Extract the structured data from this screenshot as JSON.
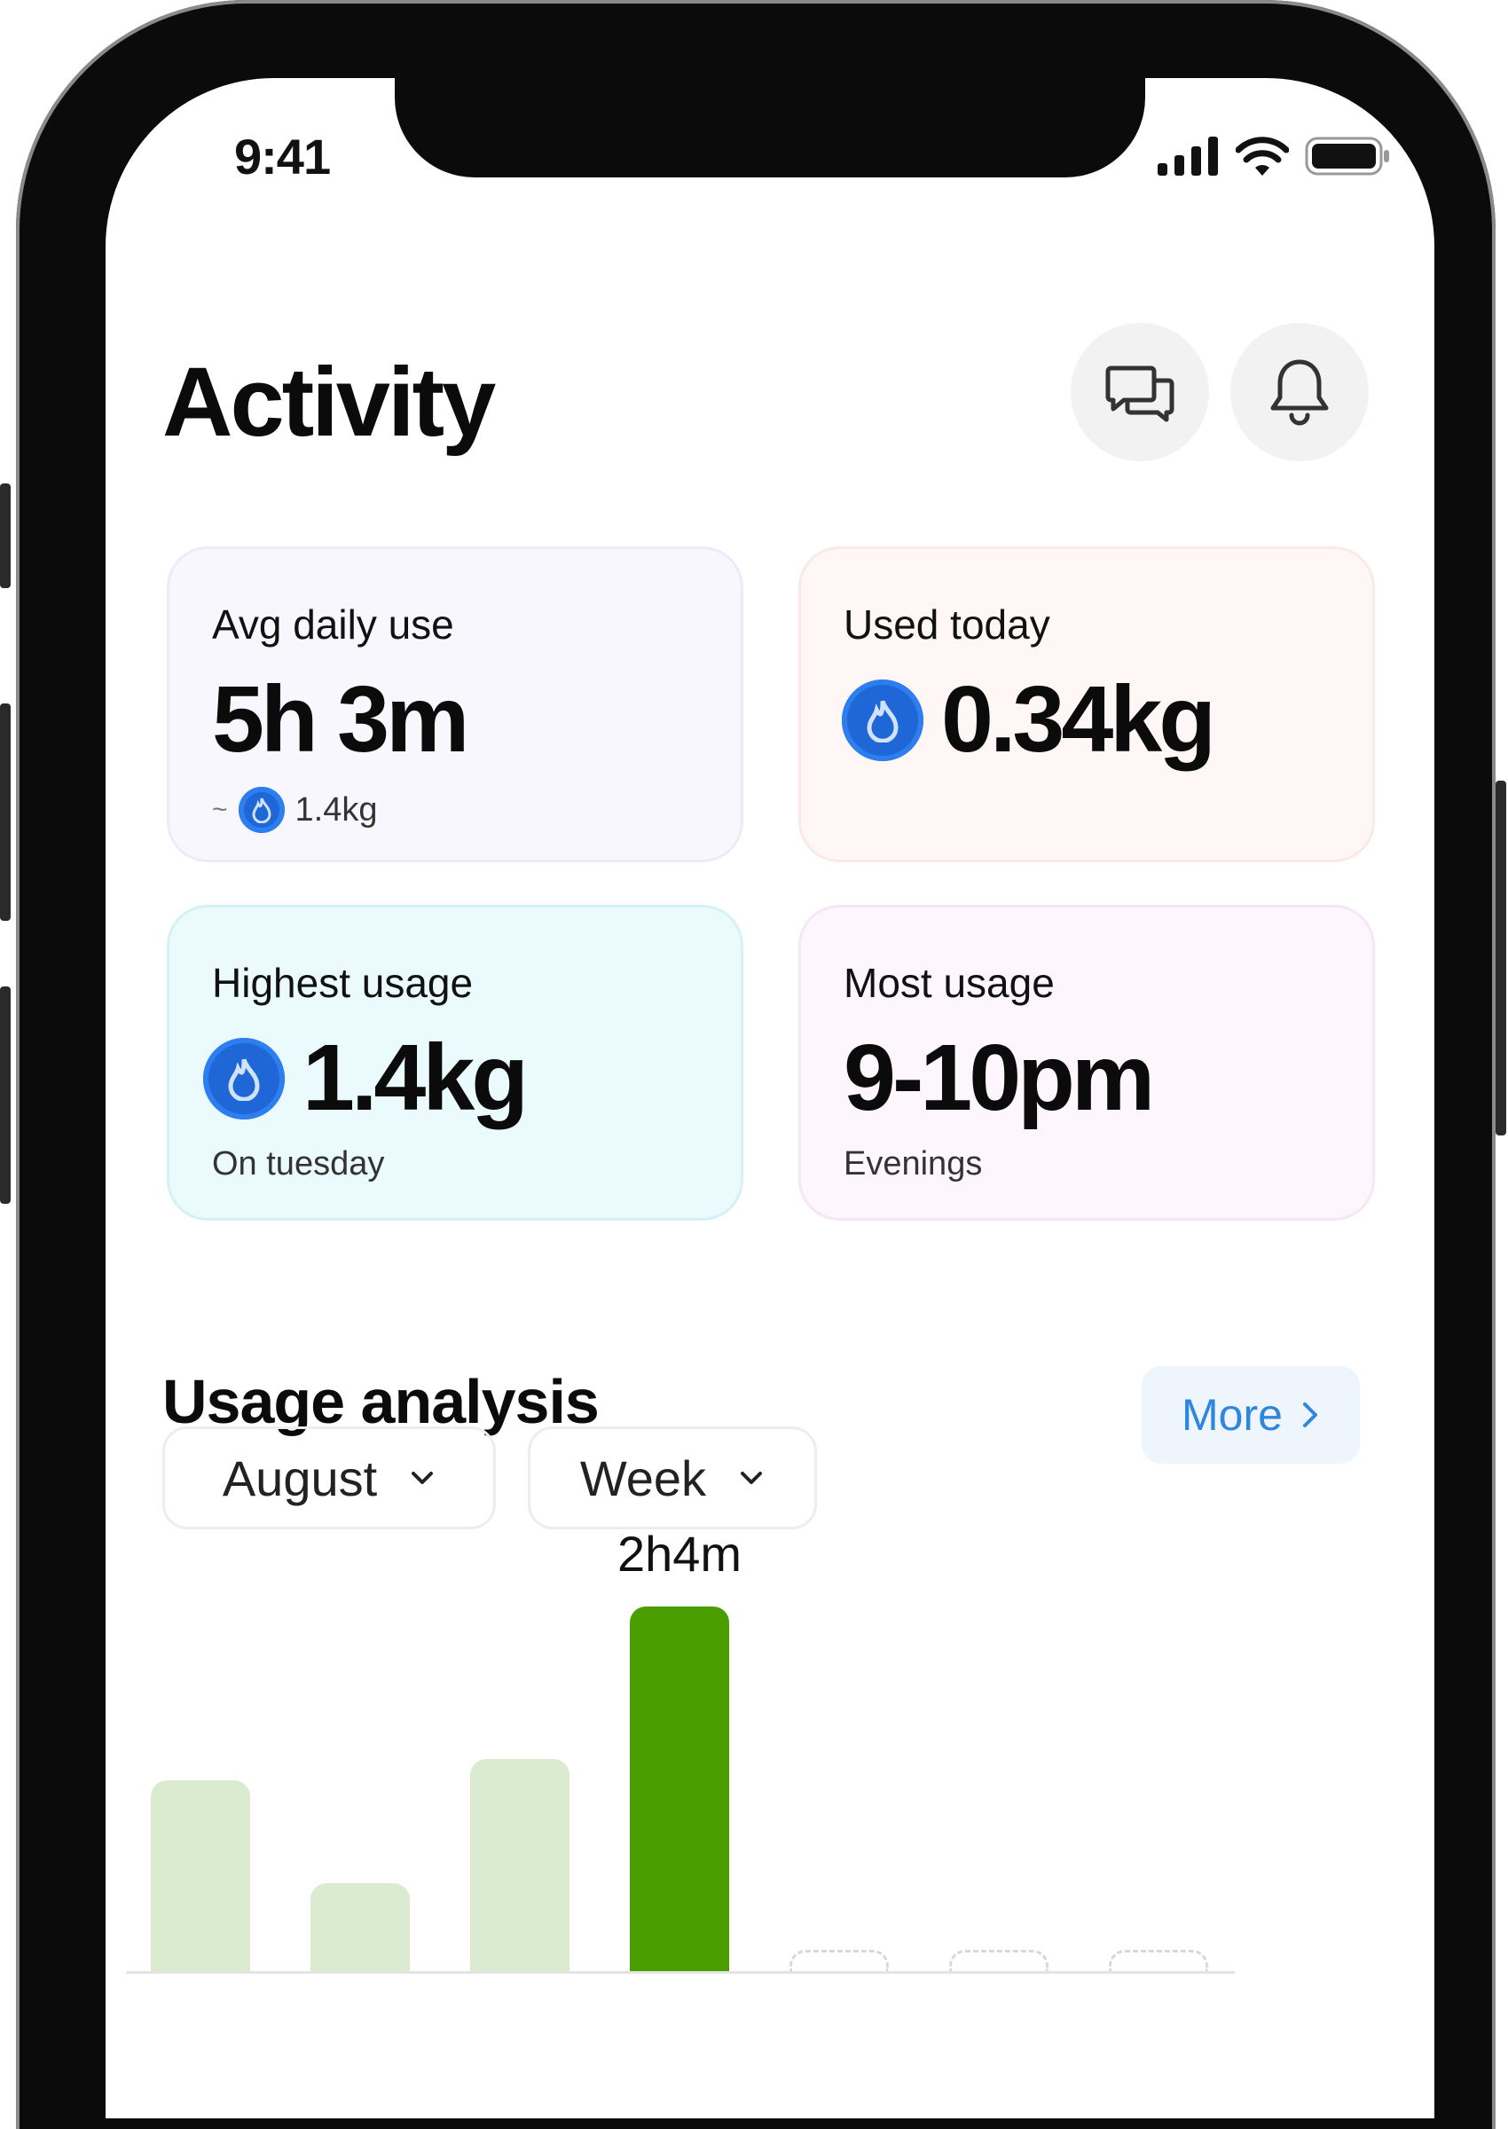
{
  "status_bar": {
    "time": "9:41"
  },
  "header": {
    "title": "Activity",
    "messages_icon": "chat-bubbles-icon",
    "notifications_icon": "bell-icon"
  },
  "cards": [
    {
      "label": "Avg daily use",
      "value": "5h 3m",
      "sub_prefix": "~",
      "sub_value": "1.4kg",
      "bg": "#f7f7fd",
      "border": "#ececf7"
    },
    {
      "label": "Used today",
      "value": "0.34kg",
      "bg": "#fff6f6",
      "border": "#fbe9e9"
    },
    {
      "label": "Highest usage",
      "value": "1.4kg",
      "sub": "On tuesday",
      "bg": "#ebfbfd",
      "border": "#d4f2f6"
    },
    {
      "label": "Most usage",
      "value": "9-10pm",
      "sub": "Evenings",
      "bg": "#fdf6fd",
      "border": "#f6e6f6"
    }
  ],
  "usage_analysis": {
    "title": "Usage analysis",
    "more_label": "More",
    "month_filter": "August",
    "period_filter": "Week"
  },
  "chart_data": {
    "type": "bar",
    "unit": "minutes",
    "values": [
      65,
      30,
      72,
      124,
      0,
      0,
      0
    ],
    "highlight_index": 3,
    "highlight_label": "2h4m",
    "colors": {
      "normal": "#dbebcf",
      "highlight": "#4b9e00"
    }
  }
}
